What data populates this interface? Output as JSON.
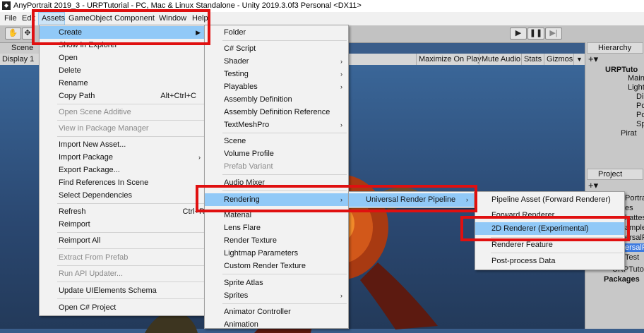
{
  "window": {
    "title": "AnyPortrait 2019_3 - URPTutorial - PC, Mac & Linux Standalone - Unity 2019.3.0f3 Personal <DX11>"
  },
  "menubar": {
    "items": [
      "File",
      "Edit",
      "Assets",
      "GameObject",
      "Component",
      "Window",
      "Help"
    ]
  },
  "scene": {
    "tab": "Scene",
    "display": "Display 1",
    "maximize": "Maximize On Play",
    "mute": "Mute Audio",
    "stats": "Stats",
    "gizmos": "Gizmos"
  },
  "hierarchy": {
    "tab": "Hierarchy",
    "rows": [
      "URPTuto",
      "Main",
      "Light",
      "Dire",
      "Poi",
      "Poi",
      "Spo",
      "Pirat"
    ]
  },
  "project": {
    "tab": "Project",
    "rows": [
      "Portra",
      "es",
      "hattes",
      "ample",
      "ersalR",
      "ersalR",
      "Test",
      "URPTutor",
      "Packages"
    ]
  },
  "assets_menu": {
    "items": [
      {
        "label": "Create"
      },
      {
        "label": "Show in Explorer"
      },
      {
        "label": "Open"
      },
      {
        "label": "Delete"
      },
      {
        "label": "Rename"
      },
      {
        "label": "Copy Path",
        "shortcut": "Alt+Ctrl+C"
      },
      {
        "label": "Open Scene Additive"
      },
      {
        "label": "View in Package Manager"
      },
      {
        "label": "Import New Asset..."
      },
      {
        "label": "Import Package"
      },
      {
        "label": "Export Package..."
      },
      {
        "label": "Find References In Scene"
      },
      {
        "label": "Select Dependencies"
      },
      {
        "label": "Refresh",
        "shortcut": "Ctrl+R"
      },
      {
        "label": "Reimport"
      },
      {
        "label": "Reimport All"
      },
      {
        "label": "Extract From Prefab"
      },
      {
        "label": "Run API Updater..."
      },
      {
        "label": "Update UIElements Schema"
      },
      {
        "label": "Open C# Project"
      }
    ]
  },
  "create_menu": {
    "items": [
      {
        "label": "Folder"
      },
      {
        "label": "C# Script"
      },
      {
        "label": "Shader"
      },
      {
        "label": "Testing"
      },
      {
        "label": "Playables"
      },
      {
        "label": "Assembly Definition"
      },
      {
        "label": "Assembly Definition Reference"
      },
      {
        "label": "TextMeshPro"
      },
      {
        "label": "Scene"
      },
      {
        "label": "Volume Profile"
      },
      {
        "label": "Prefab Variant"
      },
      {
        "label": "Audio Mixer"
      },
      {
        "label": "Rendering"
      },
      {
        "label": "Material"
      },
      {
        "label": "Lens Flare"
      },
      {
        "label": "Render Texture"
      },
      {
        "label": "Lightmap Parameters"
      },
      {
        "label": "Custom Render Texture"
      },
      {
        "label": "Sprite Atlas"
      },
      {
        "label": "Sprites"
      },
      {
        "label": "Animator Controller"
      },
      {
        "label": "Animation"
      }
    ]
  },
  "rendering_menu": {
    "items": [
      {
        "label": "Universal Render Pipeline"
      }
    ]
  },
  "urp_menu": {
    "items": [
      {
        "label": "Pipeline Asset (Forward Renderer)"
      },
      {
        "label": "Forward Renderer"
      },
      {
        "label": "2D Renderer (Experimental)"
      },
      {
        "label": "Renderer Feature"
      },
      {
        "label": "Post-process Data"
      }
    ]
  },
  "colors": {
    "highlight": "#91c9f7",
    "annotation": "#e01010",
    "menu_bg": "#f2f2f2"
  }
}
